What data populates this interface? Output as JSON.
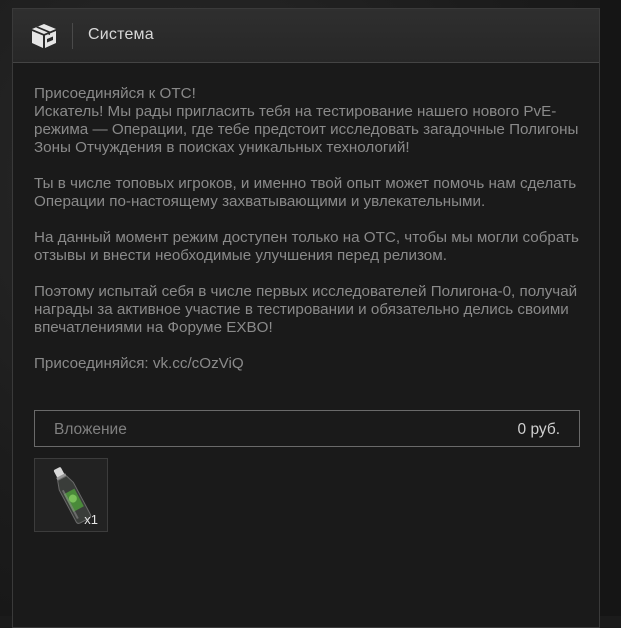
{
  "window": {
    "title": "Система",
    "title_icon": "box-icon"
  },
  "message": {
    "paragraphs": [
      "Присоединяйся к ОТС!\nИскатель! Мы рады пригласить тебя на тестирование нашего нового PvE-режима — Операции, где тебе предстоит исследовать загадочные Полигоны Зоны Отчуждения в поисках уникальных технологий!",
      "Ты в числе топовых игроков, и именно твой опыт может помочь нам сделать Операции по-настоящему захватывающими и увлекательными.",
      "На данный момент режим доступен только на ОТС, чтобы мы могли собрать отзывы и внести необходимые улучшения перед релизом.",
      "Поэтому испытай себя в числе первых исследователей Полигона-0, получай награды за активное участие в тестировании и обязательно делись своими впечатлениями на Форуме EXBO!",
      "Присоединяйся: vk.cc/cOzViQ"
    ]
  },
  "attachment": {
    "label": "Вложение",
    "value": "0  руб."
  },
  "items": [
    {
      "icon": "energy-drink-bottle-icon",
      "count": "x1"
    }
  ],
  "colors": {
    "background": "#1a1a1a",
    "titlebar": "#2b2b2b",
    "text": "#8a8a8a",
    "accent_green": "#4a8a3a"
  }
}
